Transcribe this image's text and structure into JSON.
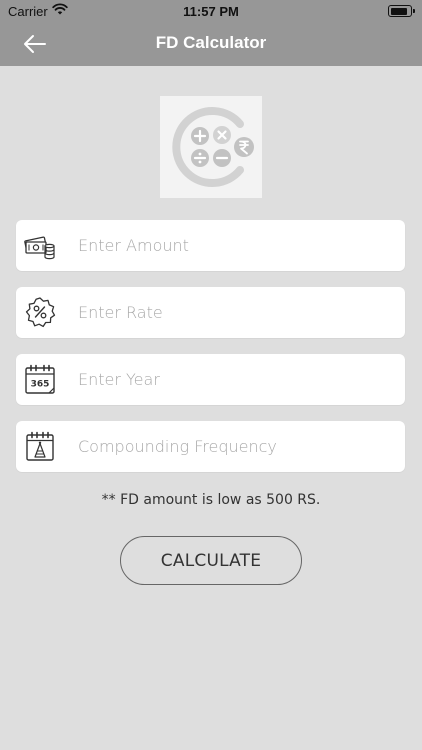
{
  "status_bar": {
    "carrier": "Carrier",
    "time": "11:57 PM"
  },
  "nav": {
    "title": "FD Calculator"
  },
  "form": {
    "amount_placeholder": "Enter Amount",
    "rate_placeholder": "Enter Rate",
    "year_placeholder": "Enter Year",
    "frequency_placeholder": "Compounding Frequency",
    "calendar_icon_label": "365"
  },
  "note": "** FD amount is low as 500 RS.",
  "calculate_label": "CALCULATE",
  "colors": {
    "nav_background": "#979797",
    "page_background": "#dedede",
    "field_background": "#ffffff"
  },
  "icons": [
    "back-arrow-icon",
    "wifi-icon",
    "battery-icon",
    "calculator-logo-icon",
    "money-icon",
    "percent-badge-icon",
    "calendar-icon",
    "frequency-calendar-icon"
  ]
}
